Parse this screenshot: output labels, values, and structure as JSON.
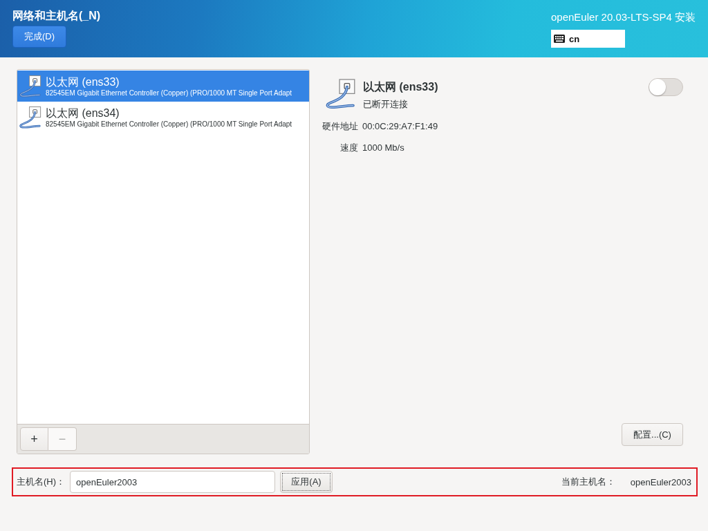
{
  "header": {
    "title": "网络和主机名(_N)",
    "done_button": "完成(D)",
    "product": "openEuler 20.03-LTS-SP4 安装",
    "keyboard_layout": "cn"
  },
  "devices": [
    {
      "name": "以太网 (ens33)",
      "description": "82545EM Gigabit Ethernet Controller (Copper) (PRO/1000 MT Single Port Adapt",
      "selected": true
    },
    {
      "name": "以太网 (ens34)",
      "description": "82545EM Gigabit Ethernet Controller (Copper) (PRO/1000 MT Single Port Adapt",
      "selected": false
    }
  ],
  "list_toolbar": [
    {
      "label": "+",
      "disabled": false
    },
    {
      "label": "−",
      "disabled": true
    }
  ],
  "detail": {
    "name": "以太网 (ens33)",
    "status": "已断开连接",
    "on": false,
    "properties": [
      {
        "label": "硬件地址",
        "value": "00:0C:29:A7:F1:49"
      },
      {
        "label": "速度",
        "value": "1000 Mb/s"
      }
    ],
    "configure_button": "配置...(C)"
  },
  "hostname": {
    "label": "主机名(H)：",
    "value": "openEuler2003",
    "apply_button": {
      "label": "应用(A)",
      "focused": true
    },
    "current_label": "当前主机名：",
    "current_value": "openEuler2003",
    "highlighted": true
  }
}
